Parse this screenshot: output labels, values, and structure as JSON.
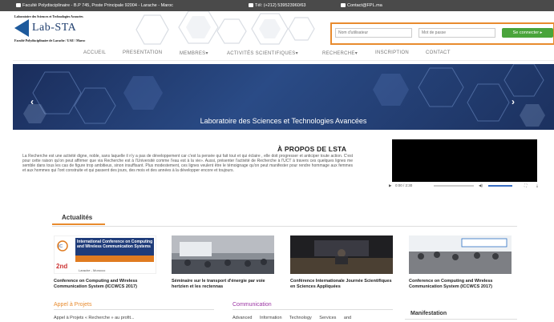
{
  "topbar": {
    "address": "Faculté Polydisciplinaire - B.P 745, Poste Principale 92004 - Larache - Maroc",
    "phone": "Tél: (+212) 539523960/63",
    "contact": "Contact@FPL.ma"
  },
  "logo": {
    "top_text": "Laboratoire des Sciences et Technologies Avancées",
    "name": "Lab-STA",
    "bottom_text": "Faculté Polydisciplinaire de Larache / UAE / Maroc"
  },
  "login": {
    "user_placeholder": "Nom d'utilisateur",
    "pass_placeholder": "Mot de passe",
    "button": "Se connecter"
  },
  "nav": {
    "items": [
      "ACCUEIL",
      "PRESENTATION",
      "MEMBRES",
      "ACTIVITÉS SCIENTIFIQUES",
      "RECHERCHE",
      "INSCRIPTION",
      "CONTACT"
    ]
  },
  "banner": {
    "caption": "Laboratoire des Sciences et Technologies Avancées",
    "prev": "‹",
    "next": "›"
  },
  "about": {
    "title": "À PROPOS DE LSTA",
    "text": "La Recherche est une activité digne, noble, sans laquelle il n'y a pas de développement car c'est la pensée qui fait tout et qui éclaire , elle doit progresser et anticiper toute action. C'est pour cette raison qu'on peut affirmer que via Recherche est à l'Université comme l'eau est à la vie». Aussi, présenter l'activité de Recherche à l'UCT à travers ces quelques lignes me semble dans tous les cas de figure trop ambitieux, sinon insuffisant. Plus modestement, ces lignes veulent être le témoignage qu'on peut manifester pour rendre hommage aux femmes et aux hommes qui l'ont construite et qui passent des jours, des mois et des années à la développer encore et toujours."
  },
  "video": {
    "time": "0:00 / 2:30"
  },
  "actualites": {
    "tab": "Actualités",
    "items": [
      {
        "title": "Conference on Computing and Wireless Communication System (ICCWCS 2017)"
      },
      {
        "title": "Séminaire sur le transport d'énergie par voie hertzien et les rectennas"
      },
      {
        "title": "Conférence Internationale Journée Scientifiques en Sciences Appliquées"
      },
      {
        "title": "Conference on Computing and Wireless Communication System (ICCWCS 2017)"
      }
    ],
    "poster_line1": "International Conference on Computing",
    "poster_line2": "and Wireless Communication Systems"
  },
  "sections": {
    "appel_title": "Appel à Projets",
    "appel_text": "Appel à Projets « Recherche » au profit...",
    "comm_title": "Communication",
    "comm_text": "Advanced Information Technology Services and",
    "manif_title": "Manifestation"
  },
  "colors": {
    "accent": "#e88b2e",
    "login_green": "#49a43b",
    "topbar": "#4a4a4a",
    "brand_blue": "#1e5a9c",
    "communication": "#9b34a4"
  }
}
